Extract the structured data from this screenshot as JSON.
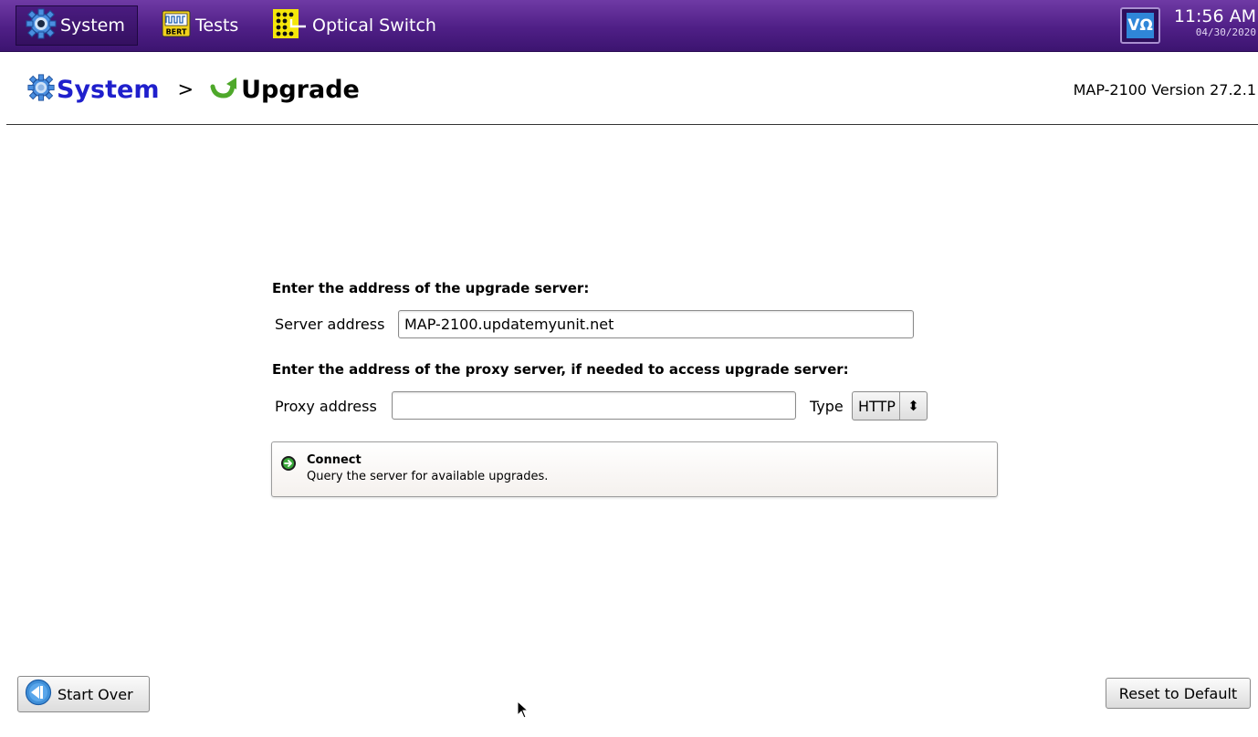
{
  "topbar": {
    "tabs": [
      {
        "label": "System",
        "icon": "gear-icon"
      },
      {
        "label": "Tests",
        "icon": "bert-icon",
        "icon_text": "BERT"
      },
      {
        "label": "Optical Switch",
        "icon": "optical-switch-icon"
      }
    ],
    "logo_text": "VΩ",
    "time": "11:56 AM",
    "date": "04/30/2020"
  },
  "header": {
    "crumb_root": "System",
    "separator": ">",
    "crumb_current": "Upgrade",
    "version": "MAP-2100 Version 27.2.1"
  },
  "form": {
    "server_heading": "Enter the address of the upgrade server:",
    "server_label": "Server address",
    "server_value": "MAP-2100.updatemyunit.net",
    "proxy_heading": "Enter the address of the proxy server, if needed to access upgrade server:",
    "proxy_label": "Proxy address",
    "proxy_value": "",
    "type_label": "Type",
    "type_value": "HTTP"
  },
  "connect": {
    "title": "Connect",
    "description": "Query the server for available upgrades."
  },
  "footer": {
    "start_over": "Start Over",
    "reset_default": "Reset to Default"
  },
  "colors": {
    "topbar": "#4f1f86",
    "breadcrumb_link": "#1f1fcc",
    "upgrade_arrow": "#4ea82a"
  }
}
